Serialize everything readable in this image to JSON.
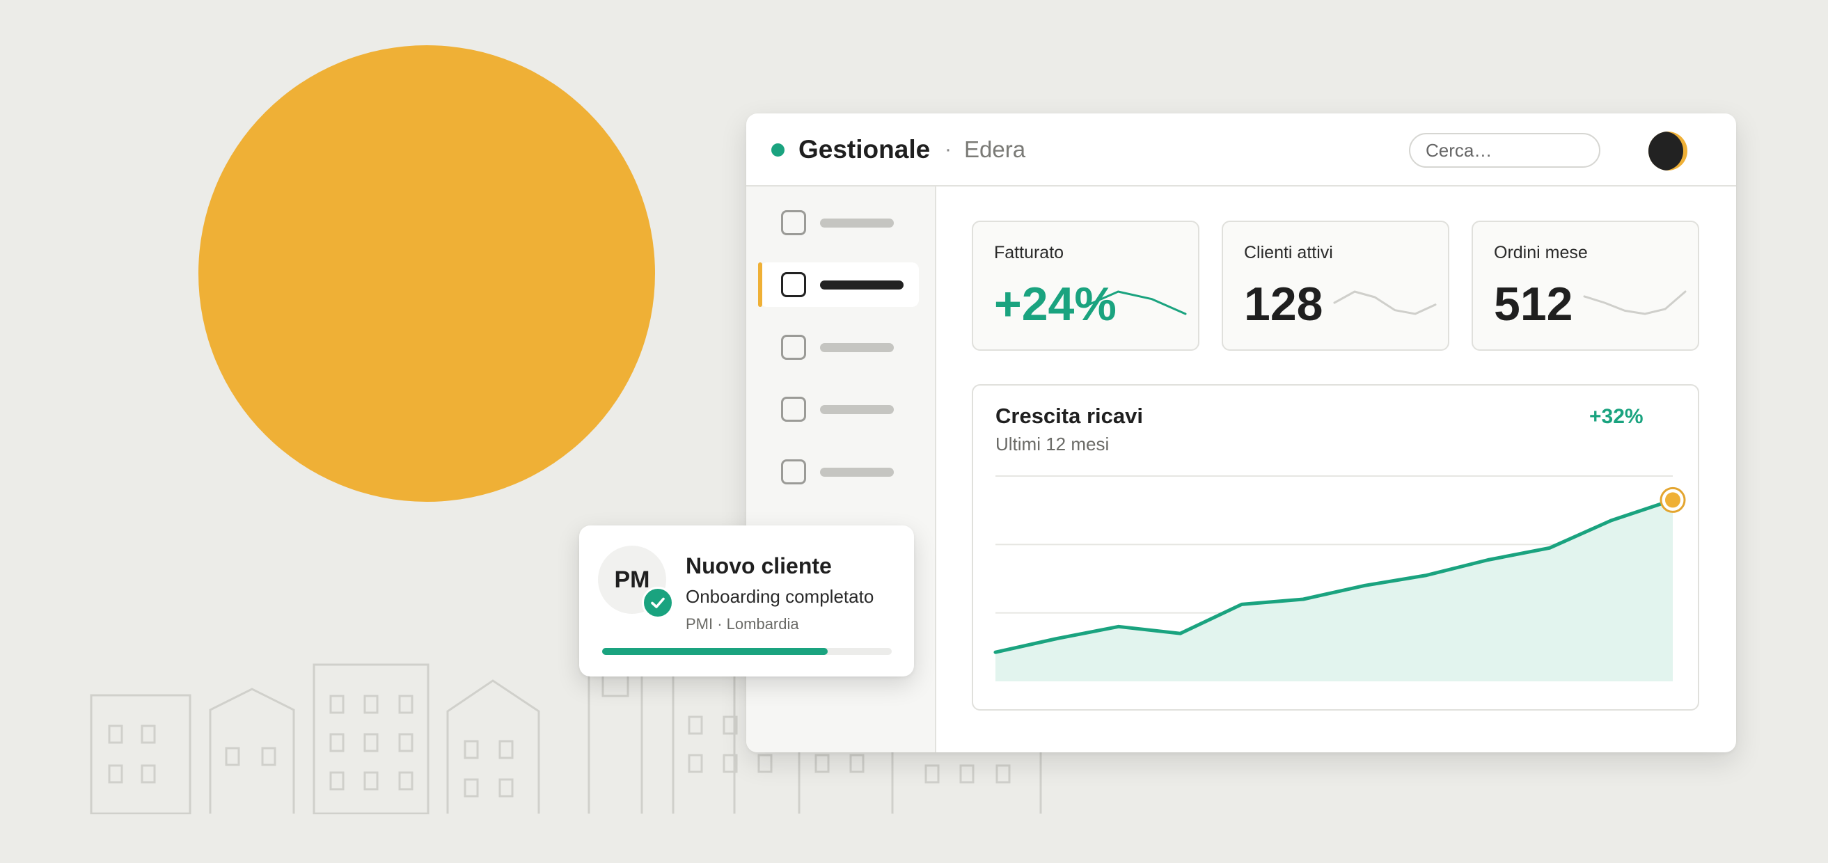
{
  "colors": {
    "background": "#ecece8",
    "accent_yellow": "#efb036",
    "accent_green": "#1aa37f",
    "text_dark": "#1f1f1f"
  },
  "header": {
    "app_title": "Gestionale",
    "separator": "·",
    "workspace": "Edera",
    "search_placeholder": "Cerca…",
    "status_icon": "status-dot-icon",
    "avatar_icon": "user-avatar-icon"
  },
  "sidebar": {
    "items": [
      {
        "icon": "checkbox-icon",
        "active": false
      },
      {
        "icon": "checkbox-icon",
        "active": true
      },
      {
        "icon": "checkbox-icon",
        "active": false
      },
      {
        "icon": "checkbox-icon",
        "active": false
      },
      {
        "icon": "checkbox-icon",
        "active": false
      }
    ]
  },
  "kpis": [
    {
      "label": "Fatturato",
      "value": "+24%",
      "positive": true,
      "trend": [
        3,
        5,
        4,
        2
      ]
    },
    {
      "label": "Clienti attivi",
      "value": "128",
      "positive": false,
      "trend": [
        3,
        3.6,
        3.3,
        2.6,
        2.4,
        2.9
      ]
    },
    {
      "label": "Ordini mese",
      "value": "512",
      "positive": false,
      "trend": [
        3.1,
        2.7,
        2.2,
        2.0,
        2.3,
        3.4
      ]
    }
  ],
  "chart": {
    "title": "Crescita ricavi",
    "subtitle": "Ultimi 12 mesi",
    "delta": "+32%"
  },
  "chart_data": {
    "type": "area",
    "title": "Crescita ricavi",
    "subtitle": "Ultimi 12 mesi",
    "values": [
      17,
      25,
      32,
      28,
      45,
      48,
      56,
      62,
      71,
      78,
      94,
      106
    ],
    "ylim": [
      0,
      120
    ],
    "grid": true,
    "highlight_last_point": true
  },
  "notification": {
    "avatar_initials": "PM",
    "title": "Nuovo cliente",
    "description": "Onboarding completato",
    "meta": "PMI · Lombardia",
    "progress": 0.78,
    "check_icon": "checkmark-icon"
  }
}
